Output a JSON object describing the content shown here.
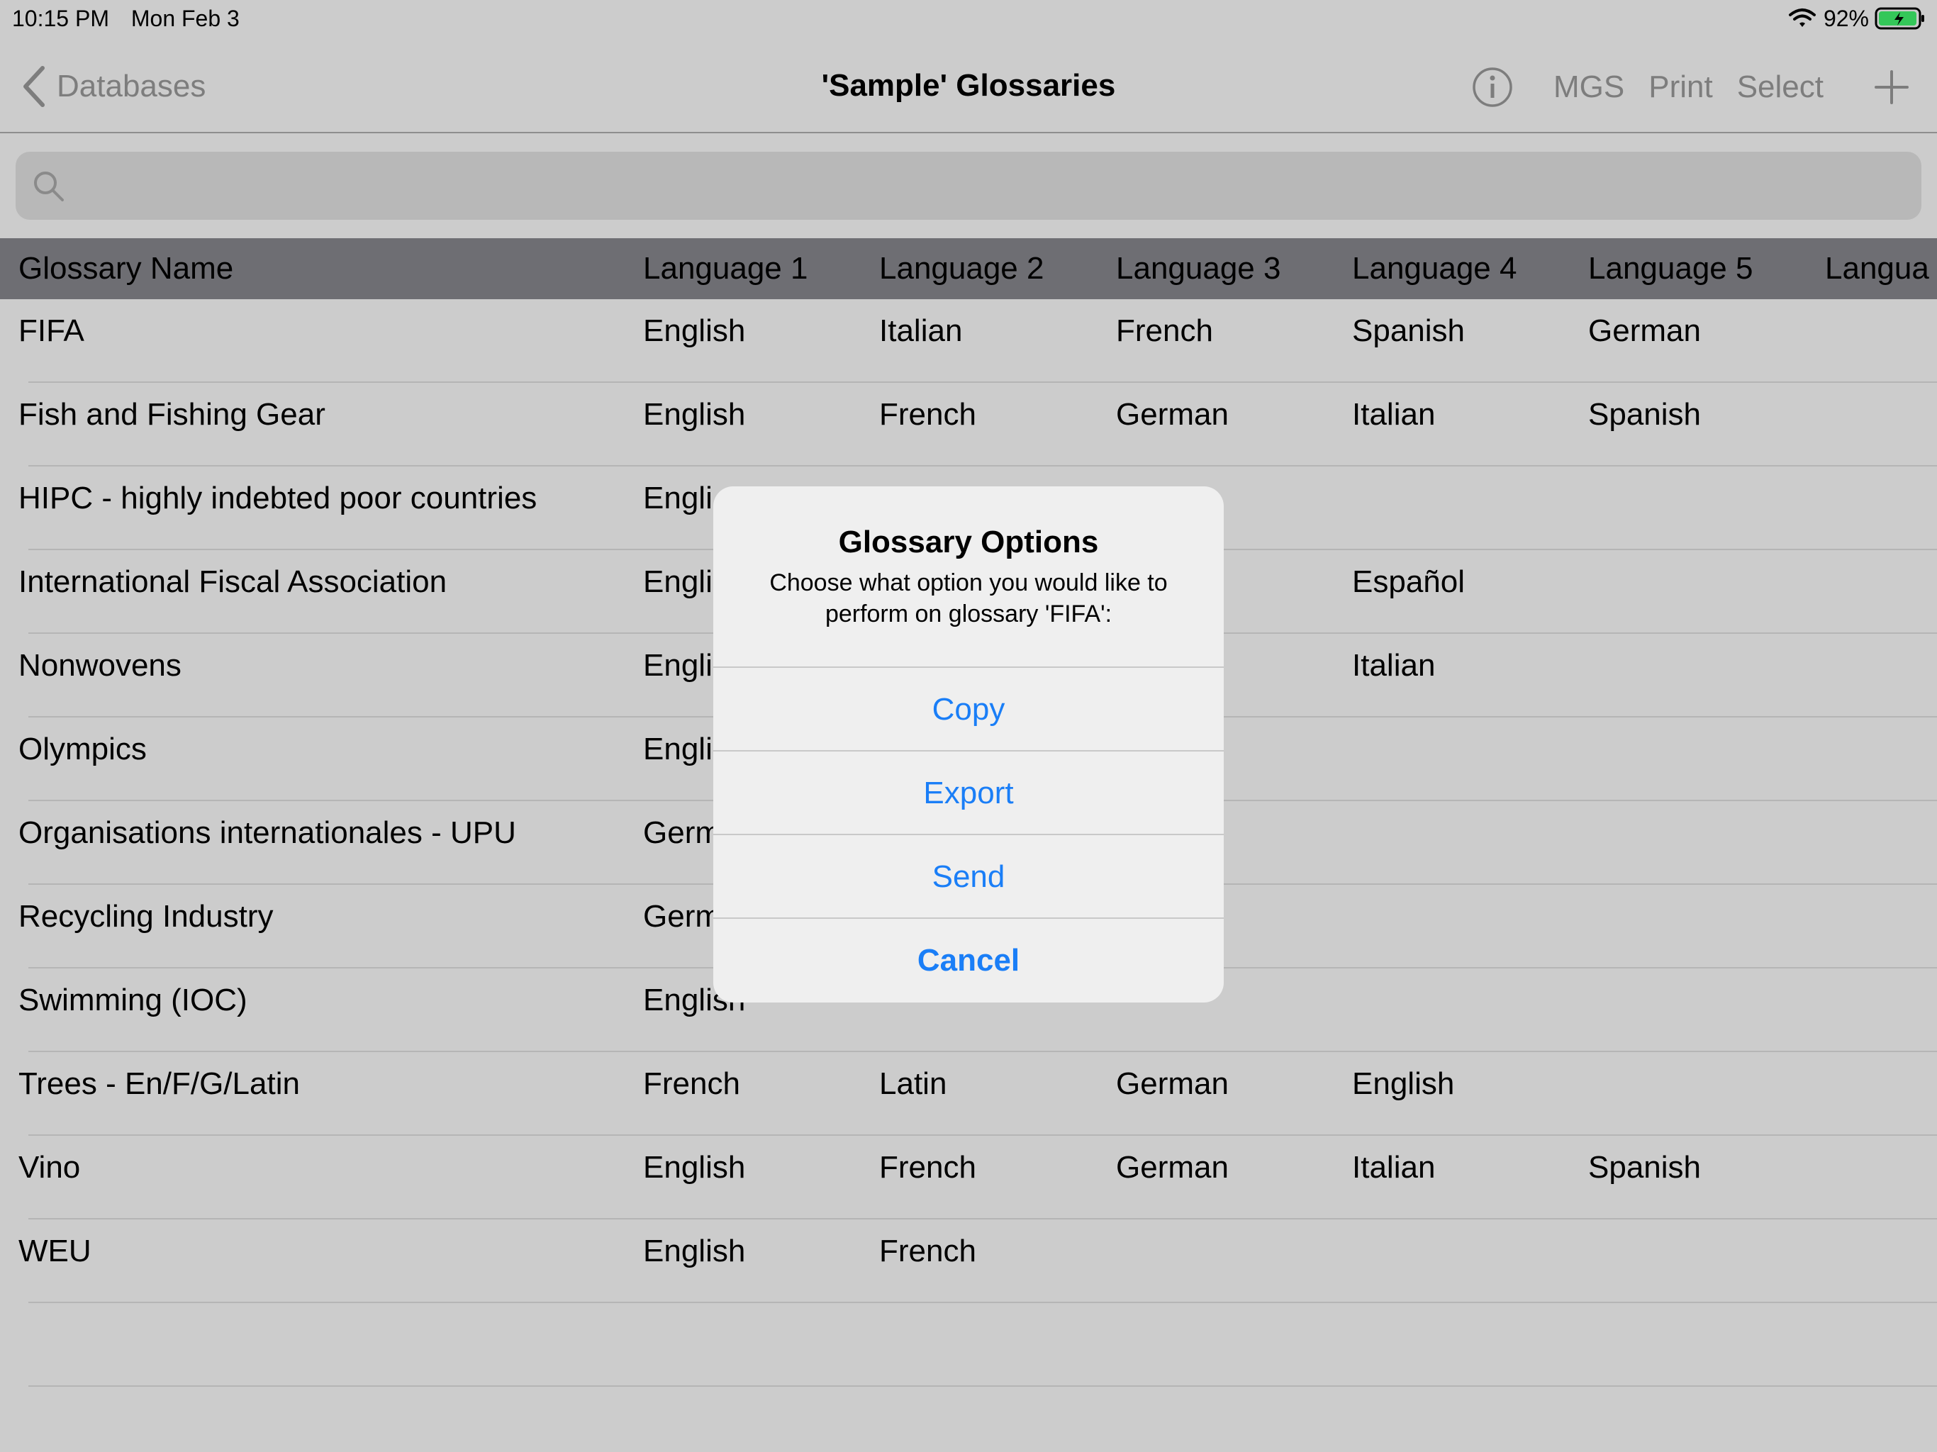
{
  "status": {
    "time": "10:15 PM",
    "date": "Mon Feb 3",
    "battery": "92%"
  },
  "nav": {
    "back": "Databases",
    "title": "'Sample' Glossaries",
    "mgs": "MGS",
    "print": "Print",
    "select": "Select"
  },
  "search": {
    "placeholder": ""
  },
  "table": {
    "headers": [
      "Glossary Name",
      "Language 1",
      "Language 2",
      "Language 3",
      "Language 4",
      "Language 5",
      "Langua"
    ],
    "rows": [
      {
        "name": "FIFA",
        "l1": "English",
        "l2": "Italian",
        "l3": "French",
        "l4": "Spanish",
        "l5": "German"
      },
      {
        "name": "Fish and Fishing Gear",
        "l1": "English",
        "l2": "French",
        "l3": "German",
        "l4": "Italian",
        "l5": "Spanish"
      },
      {
        "name": "HIPC - highly indebted poor countries",
        "l1": "Engli",
        "l2": "",
        "l3": "",
        "l4": "",
        "l5": ""
      },
      {
        "name": "International Fiscal Association",
        "l1": "Engli",
        "l2": "",
        "l3": "n",
        "l4": "Español",
        "l5": ""
      },
      {
        "name": "Nonwovens",
        "l1": "Engli",
        "l2": "",
        "l3": "n",
        "l4": "Italian",
        "l5": ""
      },
      {
        "name": "Olympics",
        "l1": "Engli",
        "l2": "",
        "l3": "s",
        "l4": "",
        "l5": ""
      },
      {
        "name": "Organisations internationales - UPU",
        "l1": "Germ",
        "l2": "",
        "l3": "",
        "l4": "",
        "l5": ""
      },
      {
        "name": "Recycling Industry",
        "l1": "Germ",
        "l2": "",
        "l3": "",
        "l4": "",
        "l5": ""
      },
      {
        "name": "Swimming (IOC)",
        "l1": "English",
        "l2": "",
        "l3": "",
        "l4": "",
        "l5": ""
      },
      {
        "name": "Trees - En/F/G/Latin",
        "l1": "French",
        "l2": "Latin",
        "l3": "German",
        "l4": "English",
        "l5": ""
      },
      {
        "name": "Vino",
        "l1": "English",
        "l2": "French",
        "l3": "German",
        "l4": "Italian",
        "l5": "Spanish"
      },
      {
        "name": "WEU",
        "l1": "English",
        "l2": "French",
        "l3": "",
        "l4": "",
        "l5": ""
      }
    ]
  },
  "alert": {
    "title": "Glossary Options",
    "message": "Choose what option you would like to perform on glossary 'FIFA':",
    "copy": "Copy",
    "export": "Export",
    "send": "Send",
    "cancel": "Cancel"
  },
  "colors": {
    "accent": "#1a7ef7",
    "header_bg": "#6e6e73",
    "page_bg": "#cccccc"
  },
  "icons": [
    "chevron-left-icon",
    "info-icon",
    "plus-icon",
    "search-icon",
    "wifi-icon",
    "battery-icon"
  ]
}
